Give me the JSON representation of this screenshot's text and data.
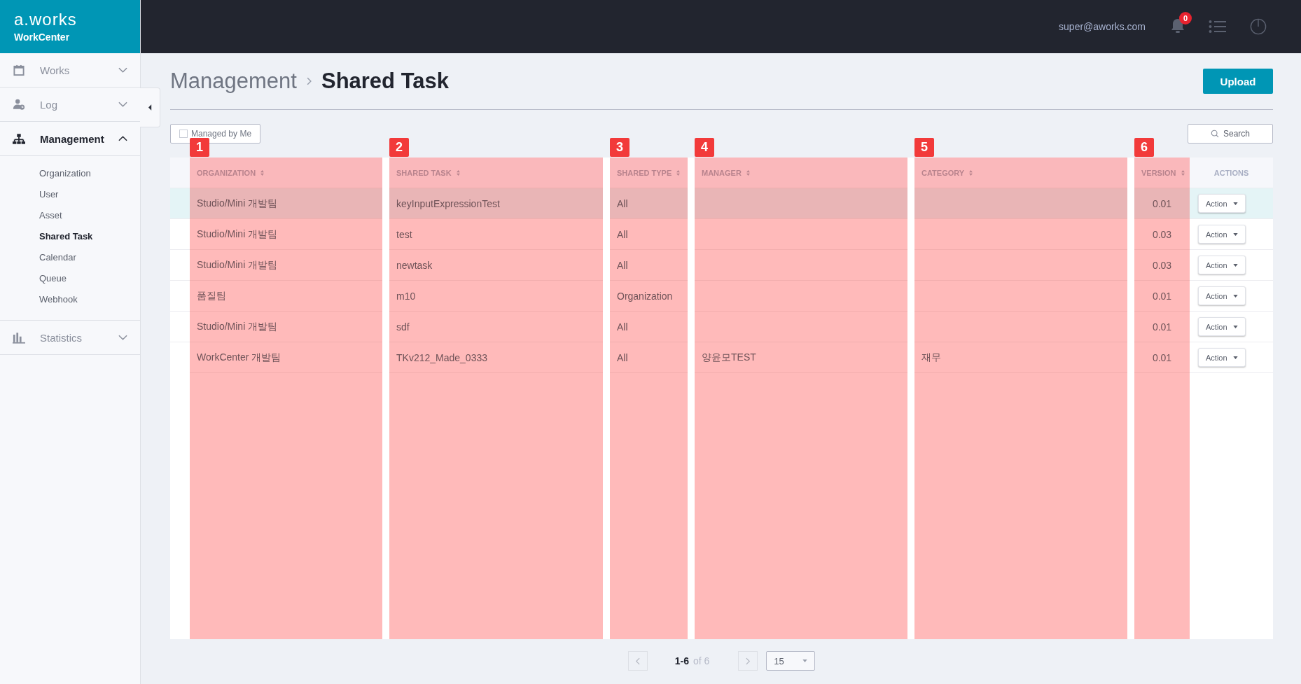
{
  "brand": {
    "logo": "a.works",
    "product": "WorkCenter"
  },
  "header": {
    "user": "super@aworks.com",
    "notifications": "0"
  },
  "sidebar": {
    "items": [
      {
        "label": "Works",
        "kind": "calendar",
        "expanded": false,
        "selected": false
      },
      {
        "label": "Log",
        "kind": "user-clock",
        "expanded": false,
        "selected": false
      },
      {
        "label": "Management",
        "kind": "hierarchy",
        "expanded": true,
        "selected": true,
        "children": [
          {
            "label": "Organization",
            "selected": false
          },
          {
            "label": "User",
            "selected": false
          },
          {
            "label": "Asset",
            "selected": false
          },
          {
            "label": "Shared Task",
            "selected": true
          },
          {
            "label": "Calendar",
            "selected": false
          },
          {
            "label": "Queue",
            "selected": false
          },
          {
            "label": "Webhook",
            "selected": false
          }
        ]
      },
      {
        "label": "Statistics",
        "kind": "bar-chart",
        "expanded": false,
        "selected": false
      }
    ]
  },
  "breadcrumb": [
    "Management",
    "Shared Task"
  ],
  "upload_button": "Upload",
  "filter": {
    "label": "Managed by Me",
    "checked": false
  },
  "search_button": "Search",
  "table": {
    "columns": [
      {
        "label": "ORGANIZATION",
        "sortable": true,
        "marker": "1"
      },
      {
        "label": "SHARED TASK",
        "sortable": true,
        "marker": "2"
      },
      {
        "label": "SHARED TYPE",
        "sortable": true,
        "marker": "3"
      },
      {
        "label": "MANAGER",
        "sortable": true,
        "marker": "4"
      },
      {
        "label": "CATEGORY",
        "sortable": true,
        "marker": "5"
      },
      {
        "label": "VERSION",
        "sortable": true,
        "marker": "6"
      },
      {
        "label": "ACTIONS",
        "sortable": false
      }
    ],
    "rows": [
      {
        "selected": true,
        "cells": [
          "Studio/Mini 개발팀",
          "keyInputExpressionTest",
          "All",
          null,
          null,
          "0.01"
        ],
        "action": "Action"
      },
      {
        "selected": false,
        "cells": [
          "Studio/Mini 개발팀",
          "test",
          "All",
          null,
          null,
          "0.03"
        ],
        "action": "Action"
      },
      {
        "selected": false,
        "cells": [
          "Studio/Mini 개발팀",
          "newtask",
          "All",
          null,
          null,
          "0.03"
        ],
        "action": "Action"
      },
      {
        "selected": false,
        "cells": [
          "품질팀",
          "m10",
          "Organization",
          null,
          null,
          "0.01"
        ],
        "action": "Action"
      },
      {
        "selected": false,
        "cells": [
          "Studio/Mini 개발팀",
          "sdf",
          "All",
          null,
          null,
          "0.01"
        ],
        "action": "Action"
      },
      {
        "selected": false,
        "cells": [
          "WorkCenter 개발팀",
          "TKv212_Made_0333",
          "All",
          "양윤모TEST",
          "재무",
          "0.01"
        ],
        "action": "Action"
      }
    ]
  },
  "pagination": {
    "range": "1-6",
    "of": "of 6",
    "page_size": "15"
  }
}
